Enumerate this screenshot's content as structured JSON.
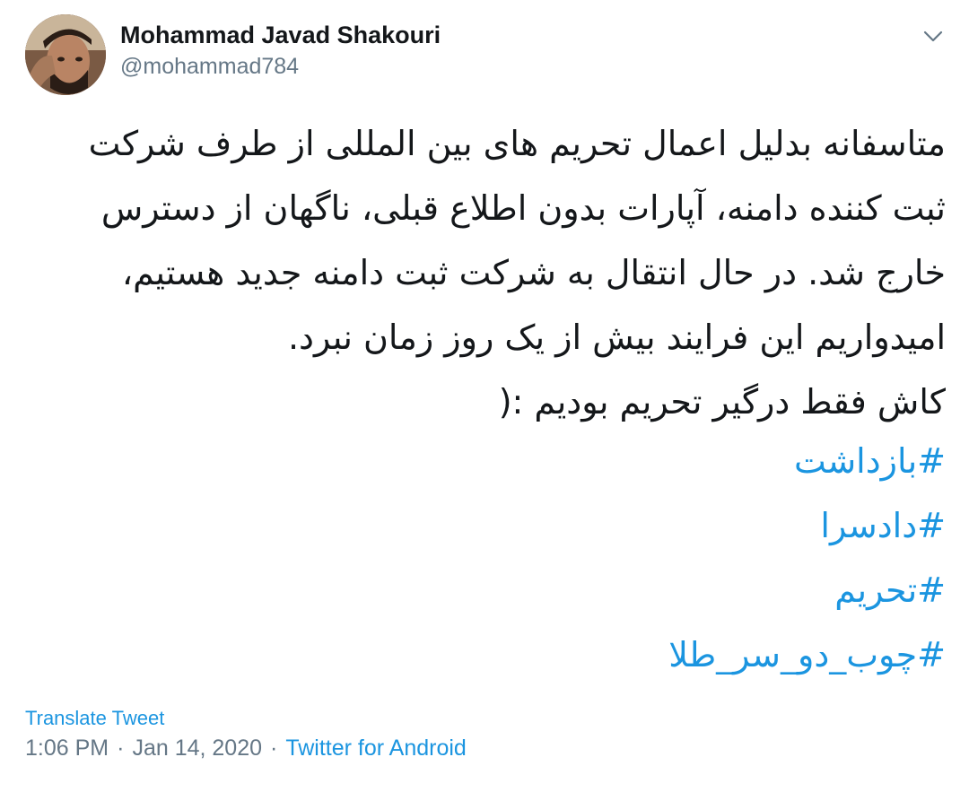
{
  "author": {
    "name": "Mohammad Javad Shakouri",
    "handle": "@mohammad784"
  },
  "tweet": {
    "lines": [
      "متاسفانه بدلیل اعمال تحریم های بین المللی از طرف شرکت",
      "ثبت کننده دامنه، آپارات بدون اطلاع قبلی، ناگهان از دسترس",
      "خارج شد. در حال انتقال به شرکت ثبت دامنه جدید هستیم،",
      "امیدواریم این فرایند بیش از یک روز زمان نبرد.",
      "کاش فقط درگیر تحریم بودیم  :("
    ],
    "hashtags": [
      "#بازداشت",
      "#دادسرا",
      "#تحریم",
      "#چوب_دو_سر_طلا"
    ]
  },
  "translate_label": "Translate Tweet",
  "meta": {
    "time": "1:06 PM",
    "separator": "·",
    "date": "Jan 14, 2020",
    "source": "Twitter for Android"
  },
  "colors": {
    "link": "#1b95e0",
    "secondary_text": "#657786",
    "primary_text": "#14171a"
  },
  "icons": {
    "caret": "chevron-down-icon"
  }
}
